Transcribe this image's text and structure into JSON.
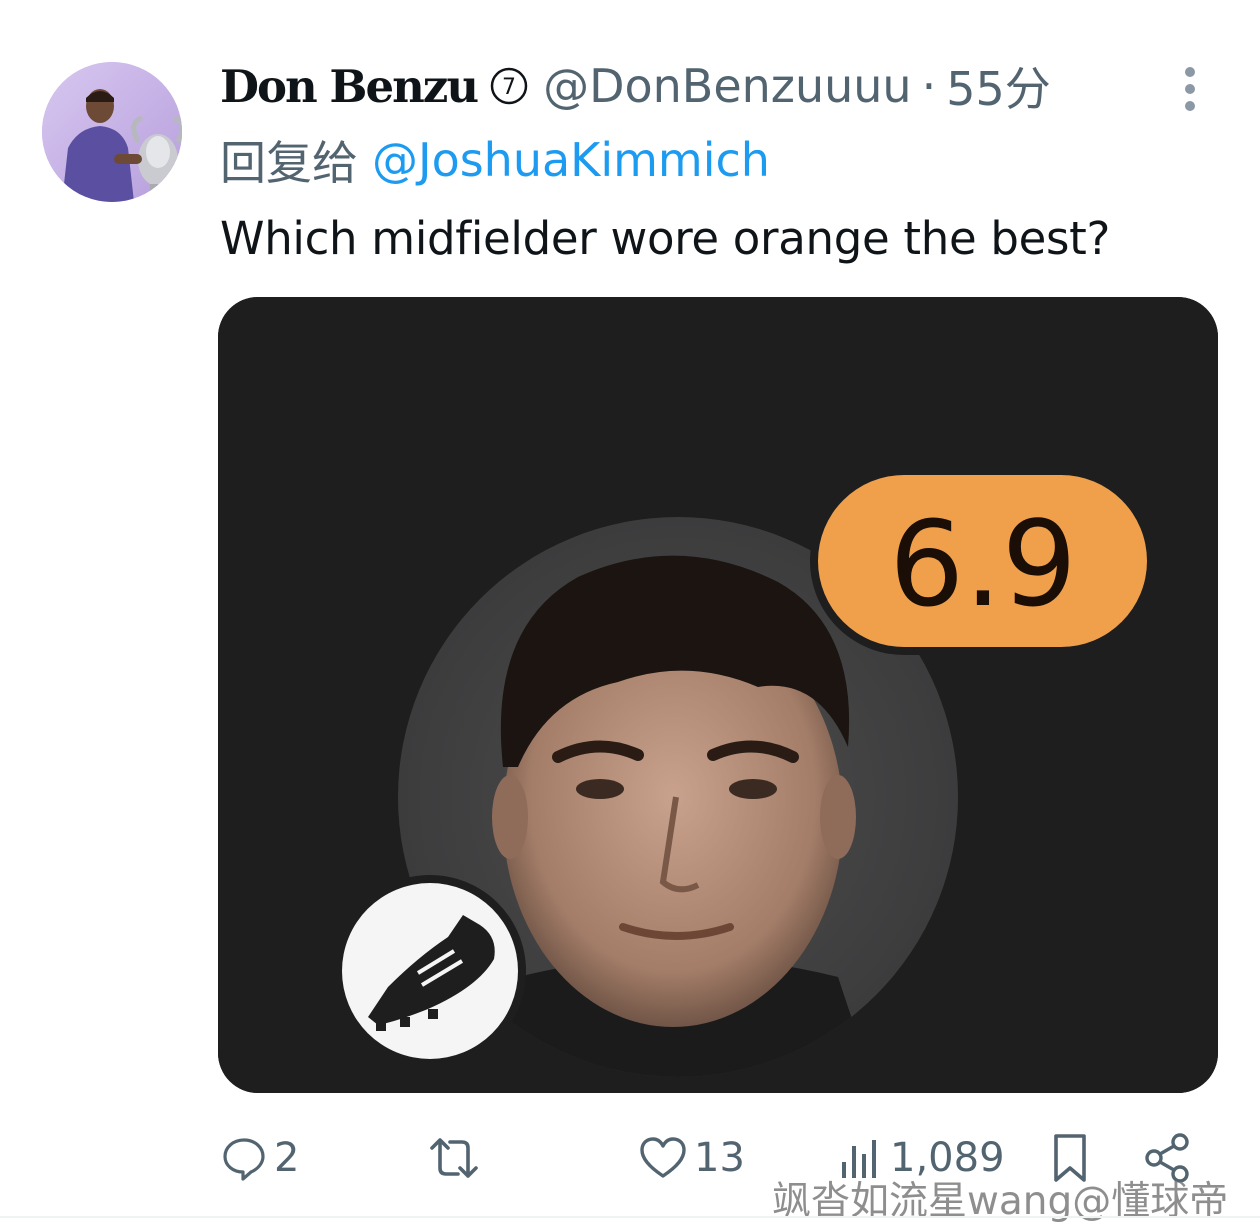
{
  "tweet": {
    "author_name": "Don Benzu",
    "verified_glyph": "⑦",
    "handle": "@DonBenzuuuu",
    "separator": "·",
    "time": "55分",
    "reply_prefix": "回复给",
    "reply_to": "@JoshuaKimmich",
    "text": "Which midfielder wore orange the best?",
    "media": {
      "rating": "6.9",
      "rating_badge_color": "#f0a04b",
      "boot_icon": "football-boot-icon"
    }
  },
  "actions": {
    "reply_count": "2",
    "retweet_count": "",
    "like_count": "13",
    "view_count": "1,089"
  },
  "icons": {
    "reply": "comment-bubble-icon",
    "retweet": "retweet-icon",
    "like": "heart-icon",
    "views": "bar-chart-icon",
    "bookmark": "bookmark-icon",
    "share": "share-icon",
    "more": "more-vertical-icon"
  },
  "colors": {
    "secondary_text": "#536471",
    "link": "#1d9bf0",
    "primary_text": "#0f1419"
  },
  "watermark": "飒沓如流星wang@懂球帝"
}
